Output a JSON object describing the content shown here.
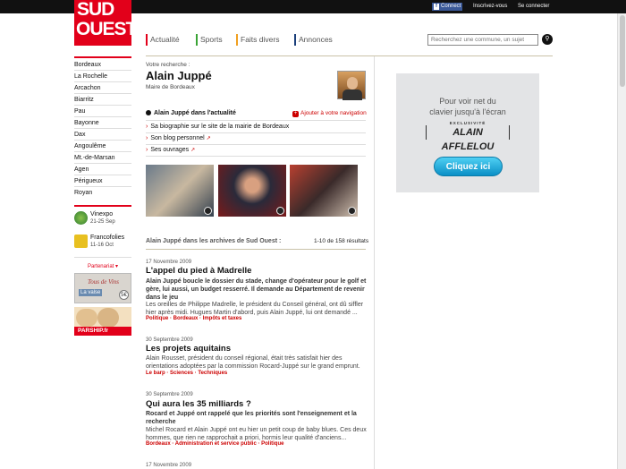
{
  "topbar": {
    "facebook_label": "Connect",
    "register_label": "Inscrivez-vous",
    "login_label": "Se connecter"
  },
  "logo": {
    "line1": "SUD",
    "line2": "OUEST"
  },
  "nav": {
    "items": [
      {
        "label": "Actualité",
        "color": "#e2001a"
      },
      {
        "label": "Sports",
        "color": "#3aa335"
      },
      {
        "label": "Faits divers",
        "color": "#f0a020"
      },
      {
        "label": "Annonces",
        "color": "#1a3e7a"
      }
    ],
    "search_placeholder": "Recherchez une commune, un sujet"
  },
  "sidebar": {
    "cities": [
      "Bordeaux",
      "La Rochelle",
      "Arcachon",
      "Biarritz",
      "Pau",
      "Bayonne",
      "Dax",
      "Angoulême",
      "Mt.-de-Marsan",
      "Agen",
      "Périgueux",
      "Royan"
    ],
    "events": [
      {
        "name": "Vinexpo",
        "dates": "21-25 Sep"
      },
      {
        "name": "Francofolies",
        "dates": "11-16 Oct"
      }
    ],
    "partner_label": "Partenariat",
    "ad1_title": "Tous de Vins",
    "ad1_caption": "La valse",
    "ad1_badge": "5€",
    "ad2_label": "PARSHIP.fr"
  },
  "search_result": {
    "label": "Votre recherche :",
    "name": "Alain Juppé",
    "role": "Maire de Bordeaux"
  },
  "actuality": {
    "title": "Alain Juppé dans l'actualité",
    "add_label": "Ajouter à votre navigation",
    "items": [
      "Sa biographie sur le site de la mairie de Bordeaux",
      "Son blog personnel",
      "Ses ouvrages"
    ]
  },
  "archive": {
    "heading": "Alain Juppé dans les archives de Sud Ouest :",
    "count": "1-10 de 158 résultats"
  },
  "results": [
    {
      "date": "17 Novembre 2009",
      "title": "L'appel du pied à Madrelle",
      "lead": "Alain Juppé boucle le dossier du stade, change d'opérateur pour le golf et gère, lui aussi, un budget resserré. Il demande au Département de revenir dans le jeu",
      "body": "Les oreilles de Philippe Madrelle, le président du Conseil général, ont dû siffler hier après midi. Hugues Martin d'abord, puis Alain Juppé, lui ont demandé ...",
      "tags": "Politique · Bordeaux · Impôts et taxes"
    },
    {
      "date": "30 Septembre 2009",
      "title": "Les projets aquitains",
      "lead": "",
      "body": "Alain Rousset, président du conseil régional, était très satisfait hier des orientations adoptées par la commission Rocard-Juppé sur le grand emprunt.",
      "tags": "Le barp · Sciences · Techniques"
    },
    {
      "date": "30 Septembre 2009",
      "title": "Qui aura les 35 milliards ?",
      "lead": "Rocard et Juppé ont rappelé que les priorités sont l'enseignement et la recherche",
      "body": "Michel Rocard et Alain Juppé ont eu hier un petit coup de baby blues. Ces deux hommes, que rien ne rapprochait a priori, hormis leur qualité d'anciens...",
      "tags": "Bordeaux · Administration et service public · Politique"
    },
    {
      "date": "17 Novembre 2009",
      "title": "",
      "lead": "",
      "body": "",
      "tags": ""
    }
  ],
  "ad": {
    "line1": "Pour voir net du",
    "line2": "clavier jusqu'à l'écran",
    "exclusive": "EXCLUSIVITÉ",
    "brand": "ALAIN AFFLELOU",
    "button": "Cliquez ici"
  }
}
